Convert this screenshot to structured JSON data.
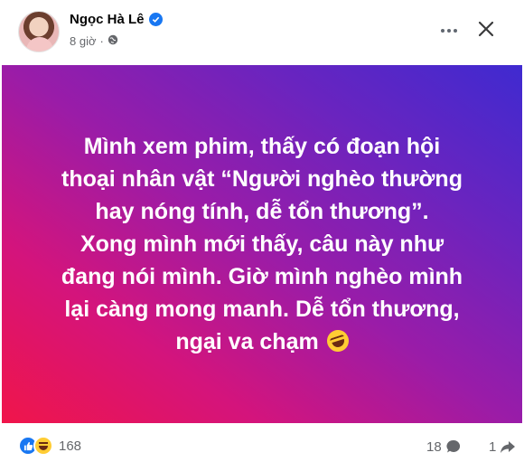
{
  "post": {
    "author_name": "Ngọc Hà Lê",
    "time_ago": "8 giờ",
    "separator": "·",
    "text": "Mình xem phim, thấy có đoạn hội\nthoại nhân vật “Người nghèo thường\nhay nóng tính, dễ tổn thương”.\nXong mình mới thấy, câu này như\nđang nói mình. Giờ mình nghèo mình\nlại càng mong manh. Dễ tổn thương,\nngại va chạm",
    "background_colors": [
      "#f0154a",
      "#d4147c",
      "#9a1ca8",
      "#6a24bf",
      "#3f2ad0"
    ]
  },
  "stats": {
    "reaction_count": "168",
    "comment_count": "18",
    "share_count": "1"
  },
  "icons": {
    "verified": "verified-badge-icon",
    "privacy": "globe-icon",
    "more": "more-options-icon",
    "close": "close-icon",
    "comment": "comment-icon",
    "share": "share-icon",
    "like": "like-reaction-icon",
    "haha": "haha-reaction-icon"
  },
  "colors": {
    "accent": "#1877f2",
    "secondary_text": "#65676b"
  }
}
